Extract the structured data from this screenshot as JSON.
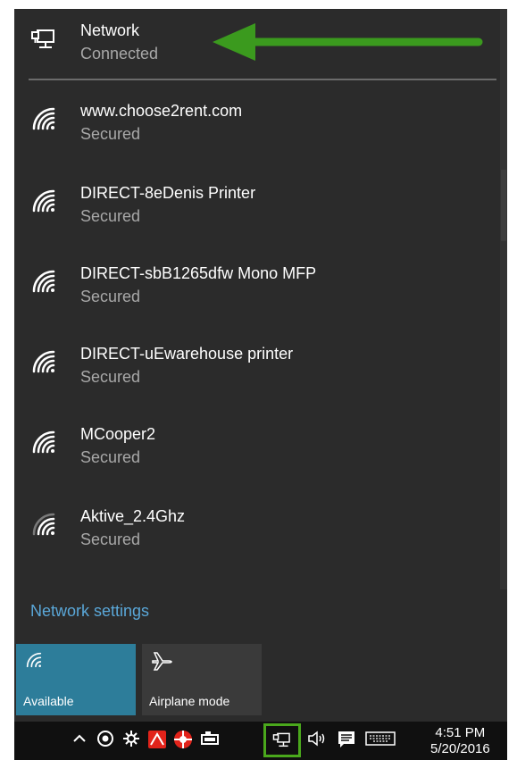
{
  "flyout": {
    "connected_network": {
      "name": "Network",
      "status": "Connected",
      "icon": "wired-network-icon"
    },
    "networks": [
      {
        "name": "www.choose2rent.com",
        "status": "Secured",
        "icon": "wifi-signal-icon"
      },
      {
        "name": "DIRECT-8eDenis Printer",
        "status": "Secured",
        "icon": "wifi-signal-icon"
      },
      {
        "name": "DIRECT-sbB1265dfw Mono MFP",
        "status": "Secured",
        "icon": "wifi-signal-icon"
      },
      {
        "name": "DIRECT-uEwarehouse printer",
        "status": "Secured",
        "icon": "wifi-signal-icon"
      },
      {
        "name": "MCooper2",
        "status": "Secured",
        "icon": "wifi-signal-icon"
      },
      {
        "name": "Aktive_2.4Ghz",
        "status": "Secured",
        "icon": "wifi-signal-weak-icon"
      }
    ],
    "settings_link": "Network settings",
    "quick_actions": [
      {
        "label": "Available",
        "icon": "wifi-icon",
        "active": true
      },
      {
        "label": "Airplane mode",
        "icon": "airplane-icon",
        "active": false
      }
    ],
    "annotation_arrow_color": "#3b9a1e"
  },
  "taskbar": {
    "tray_icons": [
      "chevron-up-icon",
      "record-icon",
      "gear-sun-icon",
      "acrobat-icon",
      "lifebuoy-icon",
      "battery-icon",
      "network-icon",
      "volume-icon",
      "action-center-icon",
      "keyboard-icon"
    ],
    "time": "4:51 PM",
    "date": "5/20/2016"
  },
  "colors": {
    "flyout_bg": "#2b2b2b",
    "accent": "#2d7d9a",
    "link": "#5aa7d8",
    "highlight_box": "#4aa81c"
  }
}
